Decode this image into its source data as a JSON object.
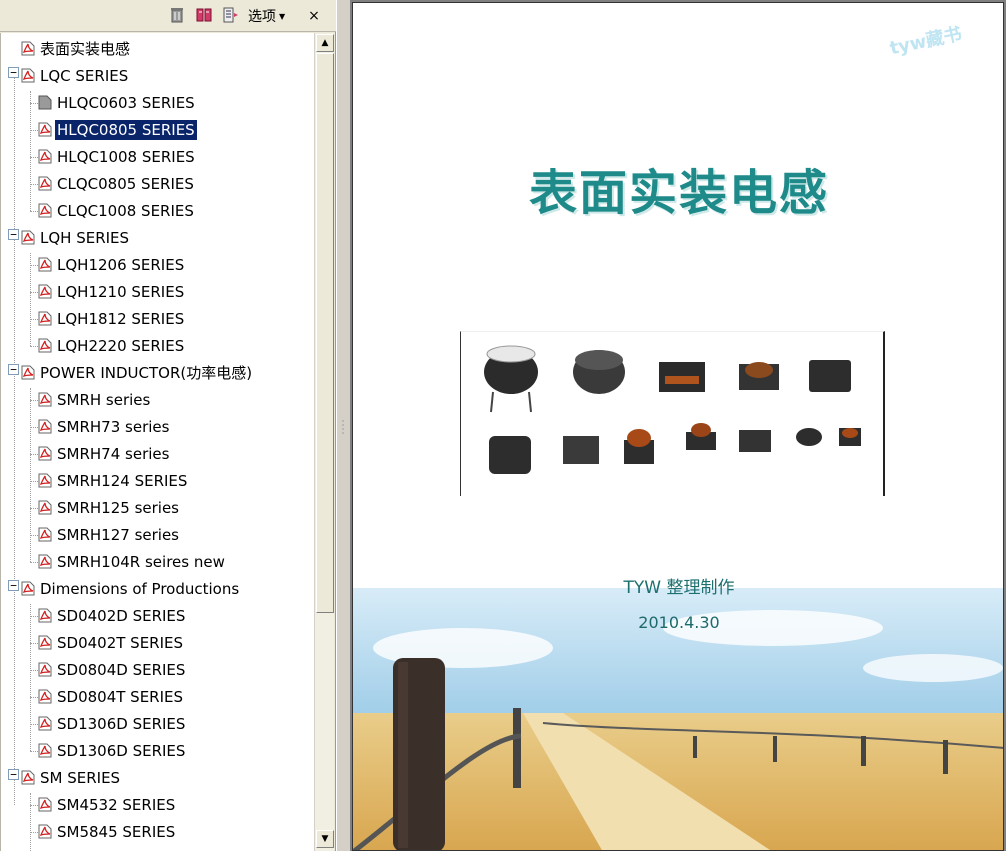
{
  "toolbar": {
    "options_label": "选项",
    "close_label": "×"
  },
  "bookmarks": {
    "root": "表面实装电感",
    "lqc": "LQC SERIES",
    "lqc_items": [
      "HLQC0603 SERIES",
      "HLQC0805 SERIES",
      "HLQC1008 SERIES",
      "CLQC0805 SERIES",
      "CLQC1008 SERIES"
    ],
    "lqh": "LQH SERIES",
    "lqh_items": [
      "LQH1206 SERIES",
      "LQH1210 SERIES",
      "LQH1812 SERIES",
      "LQH2220 SERIES"
    ],
    "power": "POWER INDUCTOR(功率电感)",
    "power_items": [
      "SMRH series",
      "SMRH73 series",
      "SMRH74 series",
      "SMRH124 SERIES",
      "SMRH125 series",
      "SMRH127 series",
      "SMRH104R seires new"
    ],
    "dims": "Dimensions of Productions",
    "dims_items": [
      "SD0402D SERIES",
      "SD0402T SERIES",
      "SD0804D SERIES",
      "SD0804T SERIES",
      "SD1306D SERIES",
      "SD1306D SERIES"
    ],
    "sm": "SM SERIES",
    "sm_items": [
      "SM4532 SERIES",
      "SM5845 SERIES"
    ],
    "selected": "HLQC0805 SERIES"
  },
  "page": {
    "title": "表面实装电感",
    "watermark": "tyw藏书",
    "credit": "TYW 整理制作",
    "date": "2010.4.30"
  },
  "colors": {
    "title_teal": "#1e8a8a",
    "selection": "#0a246a",
    "sky": "#b9dcf0",
    "sand": "#e8c47a"
  }
}
